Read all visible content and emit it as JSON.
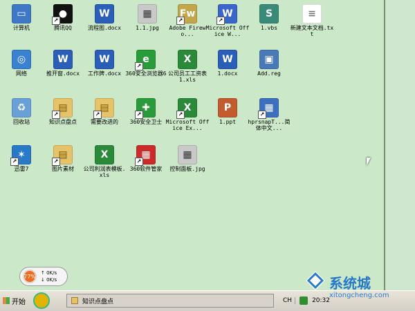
{
  "desktop": {
    "icons": [
      {
        "label": "计算机",
        "icon": "computer-icon",
        "color": "#3f78c7",
        "shortcut": false
      },
      {
        "label": "腾讯QQ",
        "icon": "qq-icon",
        "color": "#111111",
        "shortcut": true
      },
      {
        "label": "流程图.docx",
        "icon": "word-doc-icon",
        "color": "#2b5fb7",
        "shortcut": false
      },
      {
        "label": "1.1.jpg",
        "icon": "image-file-icon",
        "color": "#c9c9c9",
        "shortcut": false
      },
      {
        "label": "Adobe Firewo...",
        "icon": "fireworks-icon",
        "color": "#c4a64a",
        "shortcut": true
      },
      {
        "label": "Microsoft Office W...",
        "icon": "word-app-icon",
        "color": "#3a66c9",
        "shortcut": true
      },
      {
        "label": "1.vbs",
        "icon": "script-file-icon",
        "color": "#3a8a7a",
        "shortcut": false
      },
      {
        "label": "新建文本文档.txt",
        "icon": "text-file-icon",
        "color": "#ffffff",
        "shortcut": false
      },
      {
        "label": "网络",
        "icon": "network-icon",
        "color": "#3a82d1",
        "shortcut": false
      },
      {
        "label": "推开窗.docx",
        "icon": "word-doc-icon",
        "color": "#2b5fb7",
        "shortcut": false
      },
      {
        "label": "工作牌.docx",
        "icon": "word-doc-icon",
        "color": "#2b5fb7",
        "shortcut": false
      },
      {
        "label": "360安全浏览器6",
        "icon": "browser-icon",
        "color": "#2a9b3a",
        "shortcut": true
      },
      {
        "label": "公司员工工资表1.xls",
        "icon": "excel-file-icon",
        "color": "#2a8a3a",
        "shortcut": false
      },
      {
        "label": "1.docx",
        "icon": "word-doc-icon",
        "color": "#2b5fb7",
        "shortcut": false
      },
      {
        "label": "Add.reg",
        "icon": "registry-icon",
        "color": "#4a79b7",
        "shortcut": false
      },
      {
        "label": "回收站",
        "icon": "recycle-bin-icon",
        "color": "#6aa0d8",
        "shortcut": false
      },
      {
        "label": "知识点盘点",
        "icon": "folder-icon",
        "color": "#e6c36a",
        "shortcut": true
      },
      {
        "label": "需要改进的",
        "icon": "folder-icon",
        "color": "#e6c36a",
        "shortcut": true
      },
      {
        "label": "360安全卫士",
        "icon": "security-icon",
        "color": "#2a9b3a",
        "shortcut": true
      },
      {
        "label": "Microsoft Office Ex...",
        "icon": "excel-app-icon",
        "color": "#2a8a3a",
        "shortcut": true
      },
      {
        "label": "1.ppt",
        "icon": "ppt-file-icon",
        "color": "#c45b2e",
        "shortcut": false
      },
      {
        "label": "hprsnapT...简体中文...",
        "icon": "screenshot-tool-icon",
        "color": "#3b6fbf",
        "shortcut": true
      },
      {
        "label": "迅雷7",
        "icon": "thunder-icon",
        "color": "#2a78c8",
        "shortcut": true
      },
      {
        "label": "图片素材",
        "icon": "folder-icon",
        "color": "#e6c36a",
        "shortcut": true
      },
      {
        "label": "公司利润表模板.xls",
        "icon": "excel-file-icon",
        "color": "#2a8a3a",
        "shortcut": false
      },
      {
        "label": "360软件管家",
        "icon": "software-manager-icon",
        "color": "#cc2b2b",
        "shortcut": true
      },
      {
        "label": "控制面板.jpg",
        "icon": "image-file-icon",
        "color": "#c9c9c9",
        "shortcut": false
      }
    ]
  },
  "speed_widget": {
    "percent": "77%",
    "up": "0K/s",
    "down": "0K/s"
  },
  "taskbar": {
    "start_label": "开始",
    "task_label": "知识点盘点",
    "lang": "CH",
    "time": "20:32"
  },
  "watermark": {
    "brand": "系统城",
    "domain": "xitongcheng.com"
  }
}
